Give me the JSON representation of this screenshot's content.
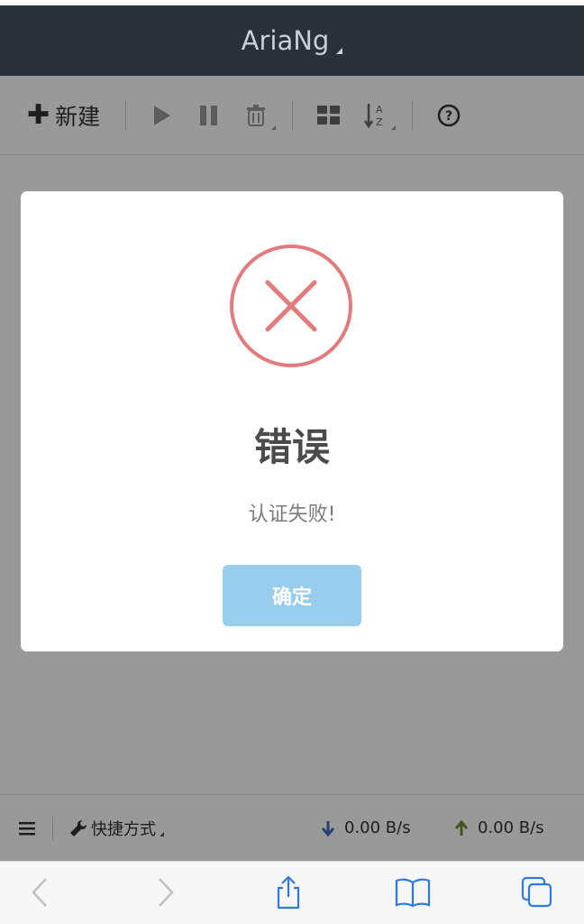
{
  "app": {
    "title": "AriaNg"
  },
  "toolbar": {
    "new_label": "新建",
    "icons": [
      "start-icon",
      "pause-icon",
      "delete-icon",
      "display-mode-icon",
      "sort-az-icon",
      "help-icon"
    ]
  },
  "modal": {
    "title": "错误",
    "message": "认证失败!",
    "ok_label": "确定",
    "icon": "error-x-circle-icon",
    "accent_color": "#e27b7b",
    "button_color": "#99cdee"
  },
  "footer": {
    "shortcut_label": "快捷方式",
    "download_speed": "0.00 B/s",
    "upload_speed": "0.00 B/s",
    "download_color": "#3e6fb5",
    "upload_color": "#6e8f2d"
  },
  "browser_bar": {
    "buttons": [
      "back-icon",
      "forward-icon",
      "share-icon",
      "bookmarks-icon",
      "tabs-icon"
    ],
    "accent": "#2f7ae0"
  }
}
